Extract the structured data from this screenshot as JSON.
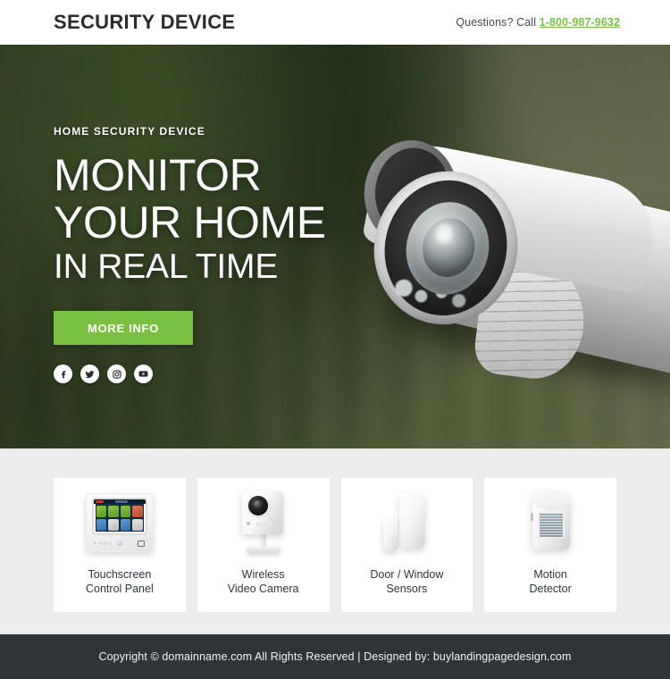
{
  "header": {
    "brand": "SECURITY DEVICE",
    "contact_prefix": "Questions? Call ",
    "phone": "1-800-987-9632",
    "phone_color": "#7ac143"
  },
  "hero": {
    "eyebrow": "HOME SECURITY DEVICE",
    "headline_line1": "MONITOR",
    "headline_line2": "YOUR HOME",
    "headline_line3": "IN REAL TIME",
    "cta_label": "MORE INFO",
    "cta_color": "#7ac143",
    "image_subject": "outdoor bullet security camera",
    "social": [
      {
        "name": "facebook-icon",
        "label": "Facebook"
      },
      {
        "name": "twitter-icon",
        "label": "Twitter"
      },
      {
        "name": "instagram-icon",
        "label": "Instagram"
      },
      {
        "name": "youtube-icon",
        "label": "YouTube"
      }
    ]
  },
  "products": {
    "background_color": "#ececec",
    "items": [
      {
        "label": "Touchscreen\nControl Panel",
        "art": "touchscreen-control-panel"
      },
      {
        "label": "Wireless\nVideo Camera",
        "art": "wireless-video-camera"
      },
      {
        "label": "Door / Window\nSensors",
        "art": "door-window-sensors"
      },
      {
        "label": "Motion\nDetector",
        "art": "motion-detector"
      }
    ]
  },
  "footer": {
    "text": "Copyright © domainname.com All Rights Reserved  |  Designed by: buylandingpagedesign.com",
    "background_color": "#2f3437"
  }
}
